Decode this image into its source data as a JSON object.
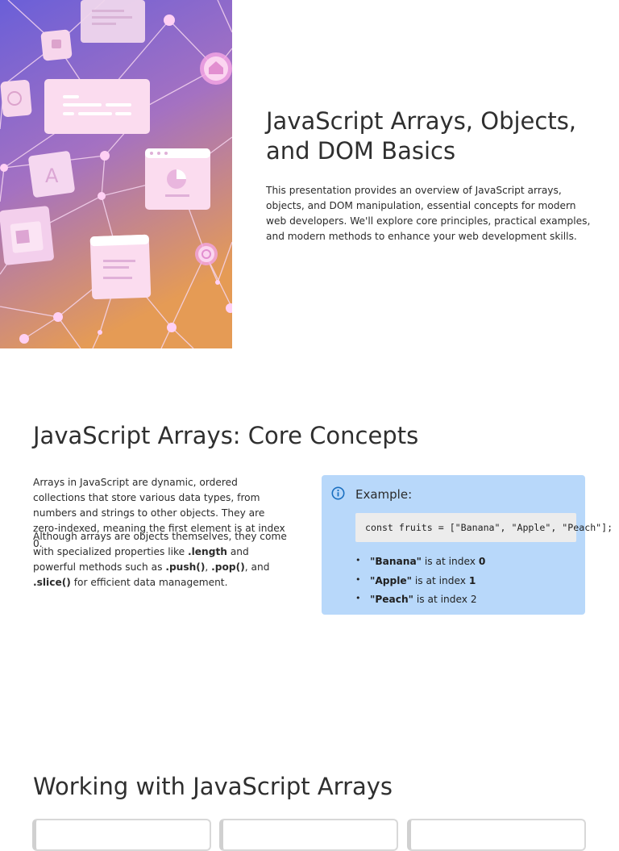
{
  "hero": {
    "title": "JavaScript Arrays, Objects, and DOM Basics",
    "description": "This presentation provides an overview of JavaScript arrays, objects, and DOM manipulation, essential concepts for modern web developers. We'll explore core principles, practical examples, and modern methods to enhance your web development skills.",
    "image_colors": {
      "top": "#6a5fd8",
      "middle": "#9a6fc4",
      "bottom": "#e09a5a"
    }
  },
  "arrays_core": {
    "title": "JavaScript Arrays: Core Concepts",
    "paragraph1": "Arrays in JavaScript are dynamic, ordered collections that store various data types, from numbers and strings to other objects. They are zero-indexed, meaning the first element is at index 0.",
    "paragraph2": {
      "text1": "Although arrays are objects themselves, they come with specialized properties like ",
      "length": ".length",
      "text2": " and powerful methods such as ",
      "push": ".push()",
      "sep1": ", ",
      "pop": ".pop()",
      "sep2": ", and ",
      "slice": ".slice()",
      "text3": " for efficient data management."
    },
    "example": {
      "icon": "info-icon",
      "label": "Example:",
      "code": "const fruits = [\"Banana\", \"Apple\", \"Peach\"];",
      "items": [
        {
          "name": "\"Banana\"",
          "text": " is at index ",
          "index": "0",
          "index_bold": true
        },
        {
          "name": "\"Apple\"",
          "text": " is at index ",
          "index": "1",
          "index_bold": true
        },
        {
          "name": "\"Peach\"",
          "text": " is at index ",
          "index": "2",
          "index_bold": false
        }
      ],
      "bullet": "•",
      "box_color": "#b8d8fa",
      "icon_color": "#1a6fc0"
    }
  },
  "working_arrays": {
    "title": "Working with JavaScript Arrays"
  }
}
